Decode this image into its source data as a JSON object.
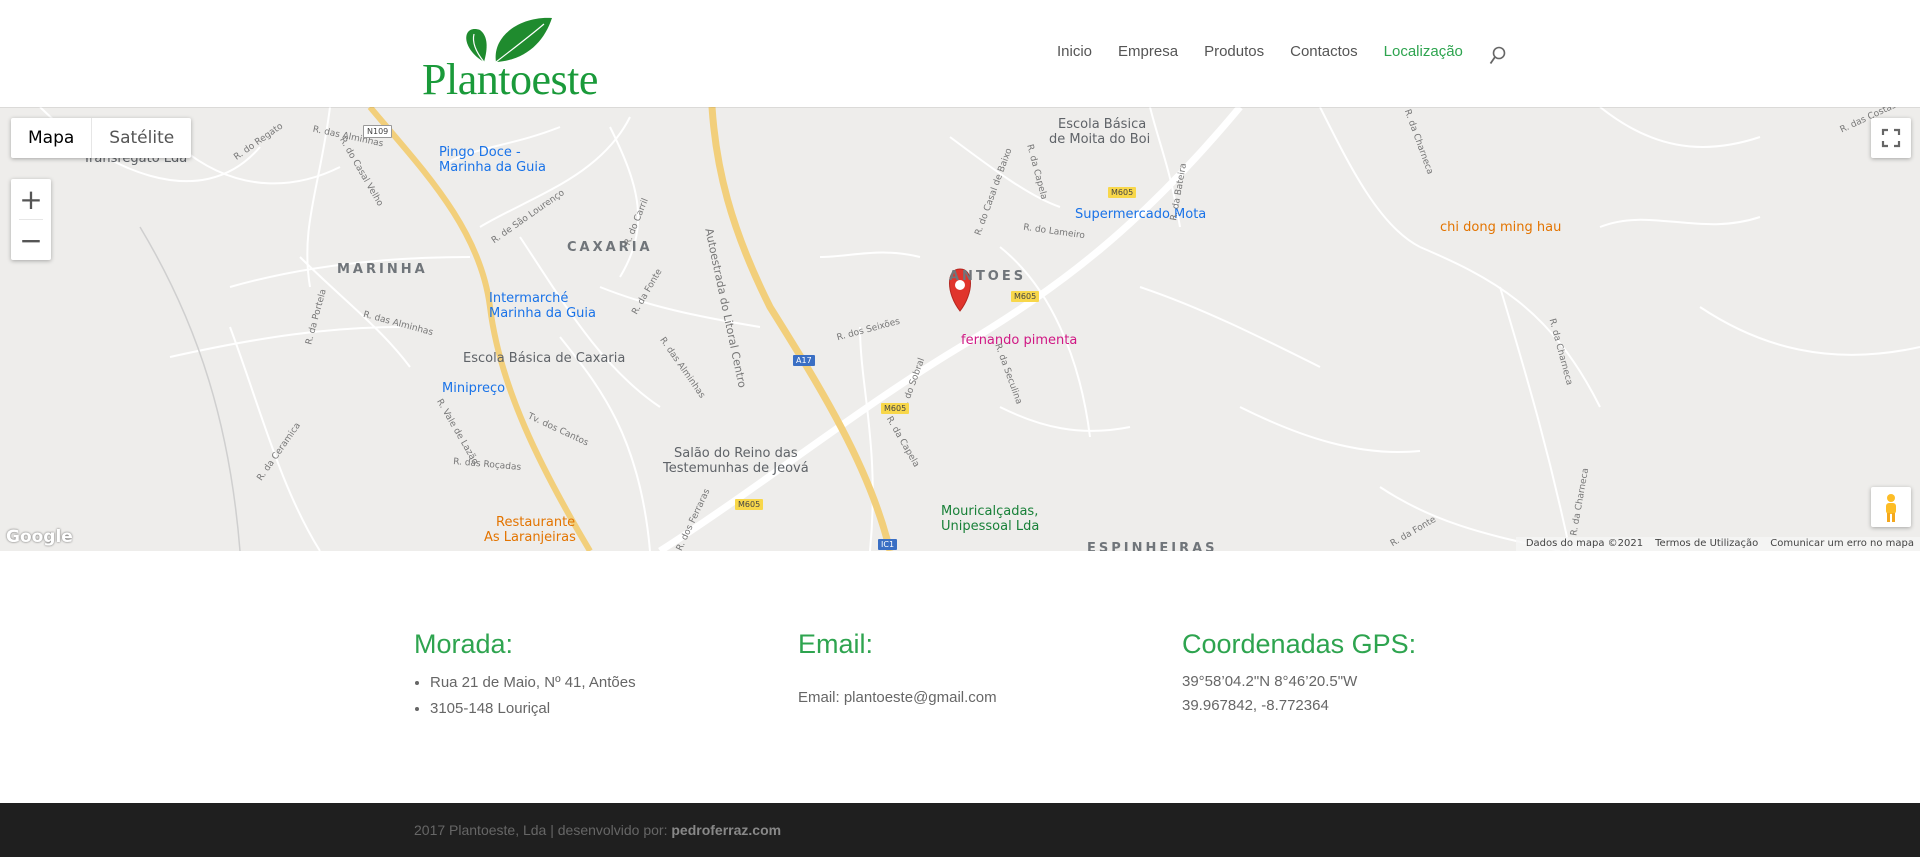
{
  "brand": {
    "name": "Plantoeste",
    "accent": "#2ea44f"
  },
  "nav": {
    "items": [
      {
        "label": "Inicio"
      },
      {
        "label": "Empresa"
      },
      {
        "label": "Produtos"
      },
      {
        "label": "Contactos"
      },
      {
        "label": "Localização",
        "active": true
      }
    ],
    "search_icon": "search-icon"
  },
  "map": {
    "type_buttons": [
      "Mapa",
      "Satélite"
    ],
    "selected_type": "Mapa",
    "zoom_in": "+",
    "zoom_out": "−",
    "provider": "Google",
    "attribution": [
      "Dados do mapa ©2021",
      "Termos de Utilização",
      "Comunicar um erro no mapa"
    ],
    "areas": [
      "MARINHA",
      "CAXARIA",
      "ANTOES",
      "ESPINHEIRAS"
    ],
    "pois": {
      "transregato": "Transregato Lda",
      "pingo_doce": [
        "Pingo Doce -",
        "Marinha da Guia"
      ],
      "escola_moita": [
        "Escola Básica",
        "de Moita do Boi"
      ],
      "supermercado": "Supermercado Mota",
      "chi_dong": "chi dong ming hau",
      "intermarche": [
        "Intermarché",
        "Marinha da Guia"
      ],
      "escola_caxaria": "Escola Básica de Caxaria",
      "fernando": "fernando pimenta",
      "minipreco": "Minipreço",
      "salao": [
        "Salão do Reino das",
        "Testemunhas de Jeová"
      ],
      "mouricalcadas": [
        "Mouricalçadas,",
        "Unipessoal Lda"
      ],
      "restaurante": [
        "Restaurante",
        "As Laranjeiras"
      ]
    },
    "roads": {
      "autoestrada": "Autoestrada do Litoral Centro",
      "shields": [
        "N109",
        "M605",
        "M605",
        "A17",
        "M605",
        "M605",
        "IC1"
      ]
    },
    "streets": [
      "R. das Alminhas",
      "R. do Regato",
      "R. do Casal Velho",
      "R. de São Lourenço",
      "R. do Carril",
      "R. da Fonte",
      "R. da Portela",
      "R. das Alminhas",
      "R. da Ceramica",
      "R. Vale de Lazão",
      "R. das Roçadas",
      "Tv. dos Cantos",
      "R. das Alminhas",
      "R. dos Seixões",
      "R. do Sobral",
      "R. da Seculina",
      "R. da Capela",
      "R. dos Ferraras",
      "R. do Casal de Baixo",
      "R. da Capela",
      "R. do Lameiro",
      "R. da Bateira",
      "R. da Charneca",
      "R. da Charneca",
      "R. da Charneca",
      "R. da Fonte",
      "R. das Costas"
    ]
  },
  "info": {
    "morada": {
      "title": "Morada:",
      "lines": [
        "Rua 21 de Maio, Nº 41, Antões",
        "3105-148 Louriçal"
      ]
    },
    "email": {
      "title": "Email:",
      "text": "Email: plantoeste@gmail.com"
    },
    "gps": {
      "title": "Coordenadas GPS:",
      "dms": "39°58’04.2\"N 8°46’20.5\"W",
      "decimal": "39.967842, -8.772364"
    }
  },
  "footer": {
    "prefix": "2017 Plantoeste, Lda | desenvolvido por: ",
    "link": "pedroferraz.com"
  }
}
